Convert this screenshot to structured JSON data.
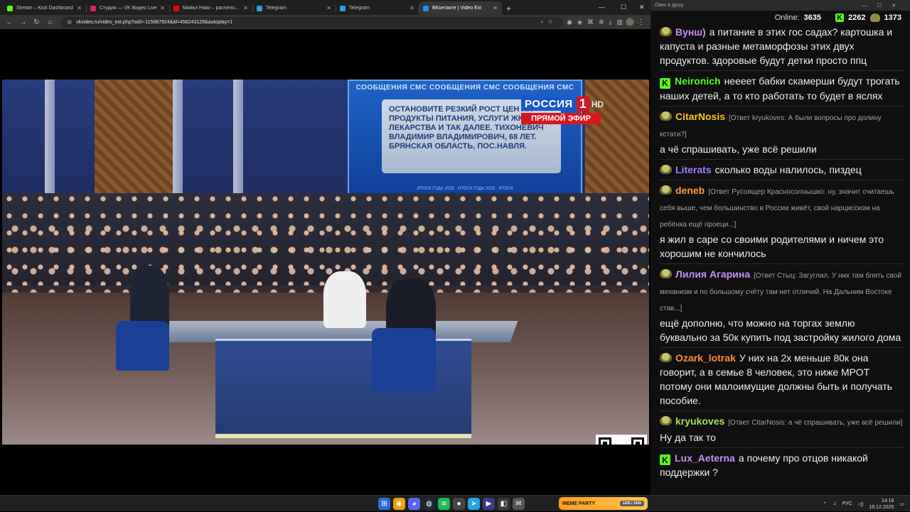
{
  "browser": {
    "tabs": [
      {
        "label": "Stream – Kick Dashboard",
        "color": "#53fc18",
        "active": false
      },
      {
        "label": "Студия — VK Видео Live",
        "color": "#e0245e",
        "active": false
      },
      {
        "label": "Майкл Наки – расчеловечивание",
        "color": "#ff0000",
        "active": false
      },
      {
        "label": "Telegram",
        "color": "#2aa3e0",
        "active": false
      },
      {
        "label": "Telegram",
        "color": "#2aa3e0",
        "active": false
      },
      {
        "label": "ВКонтакте | Video Ext",
        "color": "#2787f5",
        "active": true
      }
    ],
    "url": "vkvideo.ru/video_ext.php?oid=-115987924&id=456243129&autoplay=1"
  },
  "video": {
    "sms_banner": "СООБЩЕНИЯ СМС СООБЩЕНИЯ СМС СООБЩЕНИЯ СМС",
    "sms_text": "ОСТАНОВИТЕ РЕЗКИЙ РОСТ ЦЕН НА ПРОДУКТЫ ПИТАНИЯ, УСЛУГИ ЖКХ, ЛЕКАРСТВА И ТАК ДАЛЕЕ. ТИХОНЕВИЧ ВЛАДИМИР ВЛАДИМИРОВИЧ, 68 ЛЕТ. БРЯНСКАЯ ОБЛАСТЬ, ПОС.НАВЛЯ.",
    "years_strip": "ИТОГИ ГОДА 2025 · ИТОГИ ГОДА 2025 · ИТОГИ",
    "channel_name": "РОССИЯ",
    "channel_number": "1",
    "channel_hd": "HD",
    "live_label": "ПРЯМОЙ ЭФИР"
  },
  "chat": {
    "window_title": "Окно в душу",
    "online_label": "Online:",
    "online_count": "3635",
    "kick_count": "2262",
    "vk_count": "1373",
    "messages": [
      {
        "platform": "vk",
        "user": "Вунш)",
        "color": "#c98df0",
        "reply": "",
        "text": "а питание в этих гос садах? картошка и капуста и разные метаморфозы этих двух продуктов. здоровые будут детки просто ппц"
      },
      {
        "platform": "kick",
        "user": "Neironich",
        "color": "#53fc18",
        "reply": "",
        "text": "неееет бабки скамерши будут трогать наших детей, а то кто работать то будет в яслях"
      },
      {
        "platform": "vk",
        "user": "CitarNosis",
        "color": "#f5c518",
        "reply": "[Ответ kryukoves: А были вопросы про долину кстати?]",
        "text": "а чё спрашивать, уже всё решили"
      },
      {
        "platform": "vk",
        "user": "Literats",
        "color": "#a57cff",
        "reply": "",
        "text": "сколько воды налилось, пиздец"
      },
      {
        "platform": "vk",
        "user": "deneb",
        "color": "#ff9a3c",
        "reply": "[Ответ Русоящер Красносолнышко: ну, значит считаешь себя выше, чем большинство в России живёт, свой нарциссизм на ребёнка ещё проеци...]",
        "text": "я жил в саре со своими родителями и ничем это хорошим не кончилось"
      },
      {
        "platform": "vk",
        "user": "Лилия Агарина",
        "color": "#c98df0",
        "reply": "[Ответ Стыц: Загуглил. У них там блять свой механизм и по большому счёту там нет отличий. На Дальним Востоке став...]",
        "text": "ещё дополню, что можно на торгах землю буквально за 50к купить под застройку жилого дома"
      },
      {
        "platform": "vk",
        "user": "Ozark_lotrak",
        "color": "#ff8c3a",
        "reply": "",
        "text": "У них на 2х меньше 80к она говорит, а в семье 8 человек, это ниже МРОТ потому они малоимущие должны быть и получать пособие."
      },
      {
        "platform": "vk",
        "user": "kryukoves",
        "color": "#a6e05a",
        "reply": "[Ответ CitarNosis: а чё спрашивать, уже всё решили]",
        "text": "Ну да так то"
      },
      {
        "platform": "kick",
        "user": "Lux_Aeterna",
        "color": "#c98df0",
        "reply": "",
        "text": "а почему про отцов никакой поддержки ?"
      }
    ]
  },
  "taskbar": {
    "meme_title": "MEME PARTY",
    "meme_progress": "1325 / 1500",
    "lang": "РУС",
    "time": "14:16",
    "date": "19.12.2025"
  }
}
